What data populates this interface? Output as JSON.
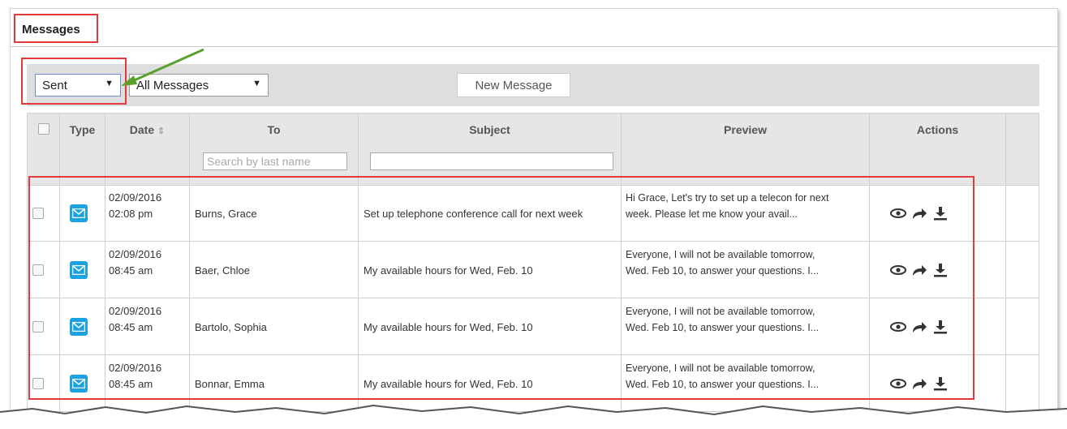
{
  "tab": {
    "label": "Messages"
  },
  "toolbar": {
    "folder_select": "Sent",
    "filter_select": "All Messages",
    "new_message": "New Message"
  },
  "table": {
    "headers": {
      "type": "Type",
      "date": "Date",
      "date_sort": "⇕",
      "to": "To",
      "subject": "Subject",
      "preview": "Preview",
      "actions": "Actions"
    },
    "search_placeholder": "Search by last name",
    "rows": [
      {
        "date": "02/09/2016",
        "time": "02:08 pm",
        "to": "Burns, Grace",
        "subject": "Set up telephone conference call for next week",
        "preview_1": "Hi Grace, Let's try to set up a telecon for next",
        "preview_2": "week. Please let me know your avail..."
      },
      {
        "date": "02/09/2016",
        "time": "08:45 am",
        "to": "Baer, Chloe",
        "subject": "My available hours for Wed, Feb. 10",
        "preview_1": "Everyone, I will not be available tomorrow,",
        "preview_2": "Wed. Feb 10, to answer your questions. I..."
      },
      {
        "date": "02/09/2016",
        "time": "08:45 am",
        "to": "Bartolo, Sophia",
        "subject": "My available hours for Wed, Feb. 10",
        "preview_1": "Everyone, I will not be available tomorrow,",
        "preview_2": "Wed. Feb 10, to answer your questions. I..."
      },
      {
        "date": "02/09/2016",
        "time": "08:45 am",
        "to": "Bonnar, Emma",
        "subject": "My available hours for Wed, Feb. 10",
        "preview_1": "Everyone, I will not be available tomorrow,",
        "preview_2": "Wed. Feb 10, to answer your questions. I..."
      }
    ]
  },
  "icons": {
    "message_type": "envelope-icon",
    "view": "eye-icon",
    "forward": "forward-arrow-icon",
    "download": "download-icon"
  },
  "colors": {
    "highlight": "#e03a3a",
    "annotation_arrow": "#5aa02c",
    "mail_icon": "#1aa3e0"
  }
}
